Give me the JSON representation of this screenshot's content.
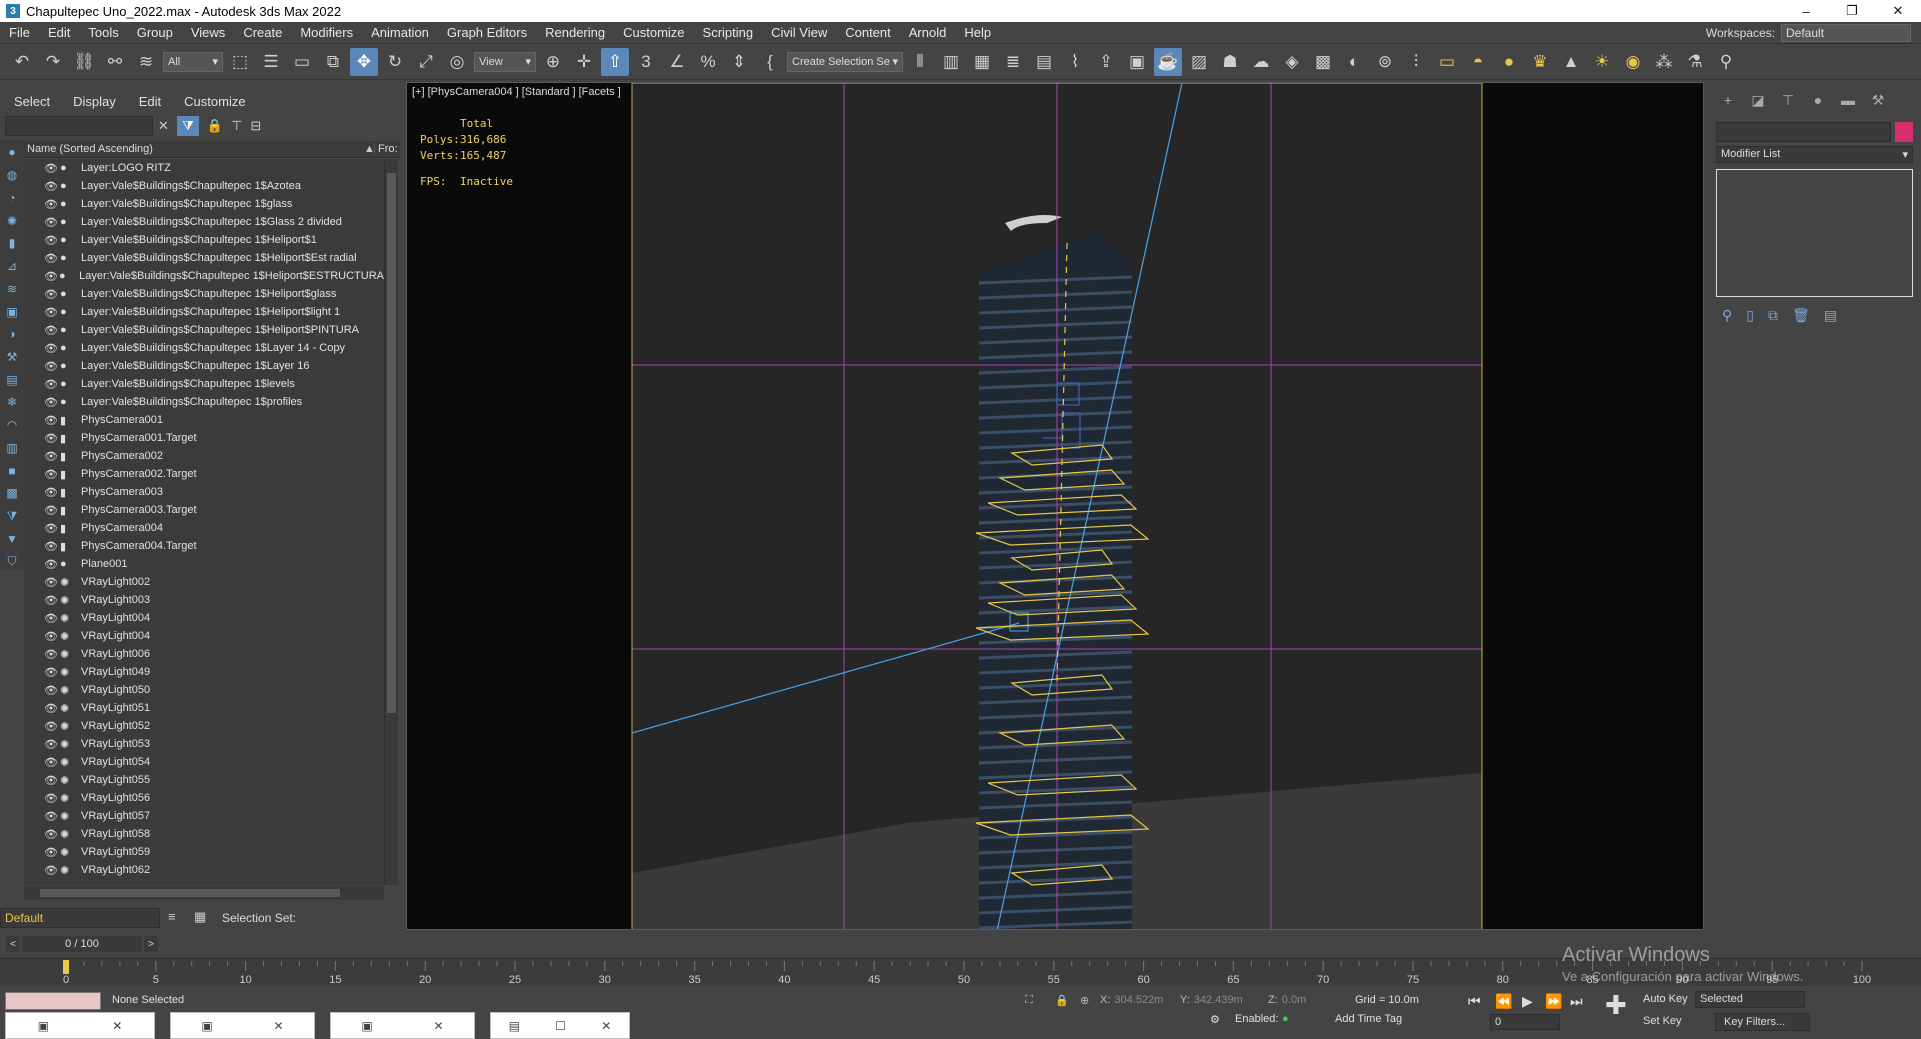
{
  "window": {
    "title": "Chapultepec Uno_2022.max - Autodesk 3ds Max 2022",
    "app_badge": "3",
    "minimize": "–",
    "maximize": "❐",
    "close": "✕"
  },
  "menu": {
    "items": [
      "File",
      "Edit",
      "Tools",
      "Group",
      "Views",
      "Create",
      "Modifiers",
      "Animation",
      "Graph Editors",
      "Rendering",
      "Customize",
      "Scripting",
      "Civil View",
      "Content",
      "Arnold",
      "Help"
    ],
    "workspaces_label": "Workspaces:",
    "workspaces_value": "Default"
  },
  "toolbar": {
    "selection_filter": "All",
    "ref_coord": "View",
    "named_selection": "Create Selection Se"
  },
  "scene_explorer": {
    "menu": [
      "Select",
      "Display",
      "Edit",
      "Customize"
    ],
    "col_name": "Name (Sorted Ascending)",
    "col_frozen": "Fro:",
    "rows": [
      {
        "name": "Layer:LOGO RITZ",
        "type": "layer"
      },
      {
        "name": "Layer:Vale$Buildings$Chapultepec 1$Azotea",
        "type": "layer"
      },
      {
        "name": "Layer:Vale$Buildings$Chapultepec 1$glass",
        "type": "layer"
      },
      {
        "name": "Layer:Vale$Buildings$Chapultepec 1$Glass 2 divided",
        "type": "layer"
      },
      {
        "name": "Layer:Vale$Buildings$Chapultepec 1$Heliport$1",
        "type": "layer"
      },
      {
        "name": "Layer:Vale$Buildings$Chapultepec 1$Heliport$Est radial",
        "type": "layer"
      },
      {
        "name": "Layer:Vale$Buildings$Chapultepec 1$Heliport$ESTRUCTURA",
        "type": "layer"
      },
      {
        "name": "Layer:Vale$Buildings$Chapultepec 1$Heliport$glass",
        "type": "layer"
      },
      {
        "name": "Layer:Vale$Buildings$Chapultepec 1$Heliport$light 1",
        "type": "layer"
      },
      {
        "name": "Layer:Vale$Buildings$Chapultepec 1$Heliport$PINTURA",
        "type": "layer"
      },
      {
        "name": "Layer:Vale$Buildings$Chapultepec 1$Layer 14 - Copy",
        "type": "layer"
      },
      {
        "name": "Layer:Vale$Buildings$Chapultepec 1$Layer 16",
        "type": "layer"
      },
      {
        "name": "Layer:Vale$Buildings$Chapultepec 1$levels",
        "type": "layer"
      },
      {
        "name": "Layer:Vale$Buildings$Chapultepec 1$profiles",
        "type": "layer"
      },
      {
        "name": "PhysCamera001",
        "type": "camera"
      },
      {
        "name": "PhysCamera001.Target",
        "type": "camera"
      },
      {
        "name": "PhysCamera002",
        "type": "camera"
      },
      {
        "name": "PhysCamera002.Target",
        "type": "camera"
      },
      {
        "name": "PhysCamera003",
        "type": "camera"
      },
      {
        "name": "PhysCamera003.Target",
        "type": "camera"
      },
      {
        "name": "PhysCamera004",
        "type": "camera"
      },
      {
        "name": "PhysCamera004.Target",
        "type": "camera"
      },
      {
        "name": "Plane001",
        "type": "geo"
      },
      {
        "name": "VRayLight002",
        "type": "light"
      },
      {
        "name": "VRayLight003",
        "type": "light"
      },
      {
        "name": "VRayLight004",
        "type": "light"
      },
      {
        "name": "VRayLight004",
        "type": "light"
      },
      {
        "name": "VRayLight006",
        "type": "light"
      },
      {
        "name": "VRayLight049",
        "type": "light"
      },
      {
        "name": "VRayLight050",
        "type": "light"
      },
      {
        "name": "VRayLight051",
        "type": "light"
      },
      {
        "name": "VRayLight052",
        "type": "light"
      },
      {
        "name": "VRayLight053",
        "type": "light"
      },
      {
        "name": "VRayLight054",
        "type": "light"
      },
      {
        "name": "VRayLight055",
        "type": "light"
      },
      {
        "name": "VRayLight056",
        "type": "light"
      },
      {
        "name": "VRayLight057",
        "type": "light"
      },
      {
        "name": "VRayLight058",
        "type": "light"
      },
      {
        "name": "VRayLight059",
        "type": "light"
      },
      {
        "name": "VRayLight062",
        "type": "light"
      }
    ],
    "layer_value": "Default",
    "selection_set_label": "Selection Set:"
  },
  "viewport": {
    "label": "[+] [PhysCamera004 ] [Standard ] [Facets ]",
    "stats": {
      "total_label": "Total",
      "polys_label": "Polys:",
      "polys": "316,686",
      "verts_label": "Verts:",
      "verts": "165,487",
      "fps_label": "FPS:",
      "fps": "Inactive"
    }
  },
  "command_panel": {
    "modifier_list": "Modifier List"
  },
  "timeline": {
    "slider": "0 / 100",
    "ticks": [
      "0",
      "5",
      "10",
      "15",
      "20",
      "25",
      "30",
      "35",
      "40",
      "45",
      "50",
      "55",
      "60",
      "65",
      "70",
      "75",
      "80",
      "85",
      "90",
      "95",
      "100"
    ]
  },
  "status": {
    "selection": "None Selected",
    "x_label": "X:",
    "x": "304.522m",
    "y_label": "Y:",
    "y": "342.439m",
    "z_label": "Z:",
    "z": "0.0m",
    "grid": "Grid = 10.0m",
    "enabled_label": "Enabled:",
    "add_time_tag": "Add Time Tag",
    "auto_key": "Auto Key",
    "selected": "Selected",
    "set_key": "Set Key",
    "key_filters": "Key Filters...",
    "frame": "0"
  },
  "watermark": {
    "line1": "Activar Windows",
    "line2": "Ve a Configuración para activar Windows."
  },
  "icons": {
    "eye": "eye-icon",
    "light": "light-bulb-icon",
    "camera": "camera-icon",
    "layer": "layer-icon"
  },
  "colors": {
    "accent": "#5b87b9",
    "selection_yellow": "#e8c84a",
    "grid_magenta": "#b040b0",
    "camera_line": "#4aa3e8"
  }
}
